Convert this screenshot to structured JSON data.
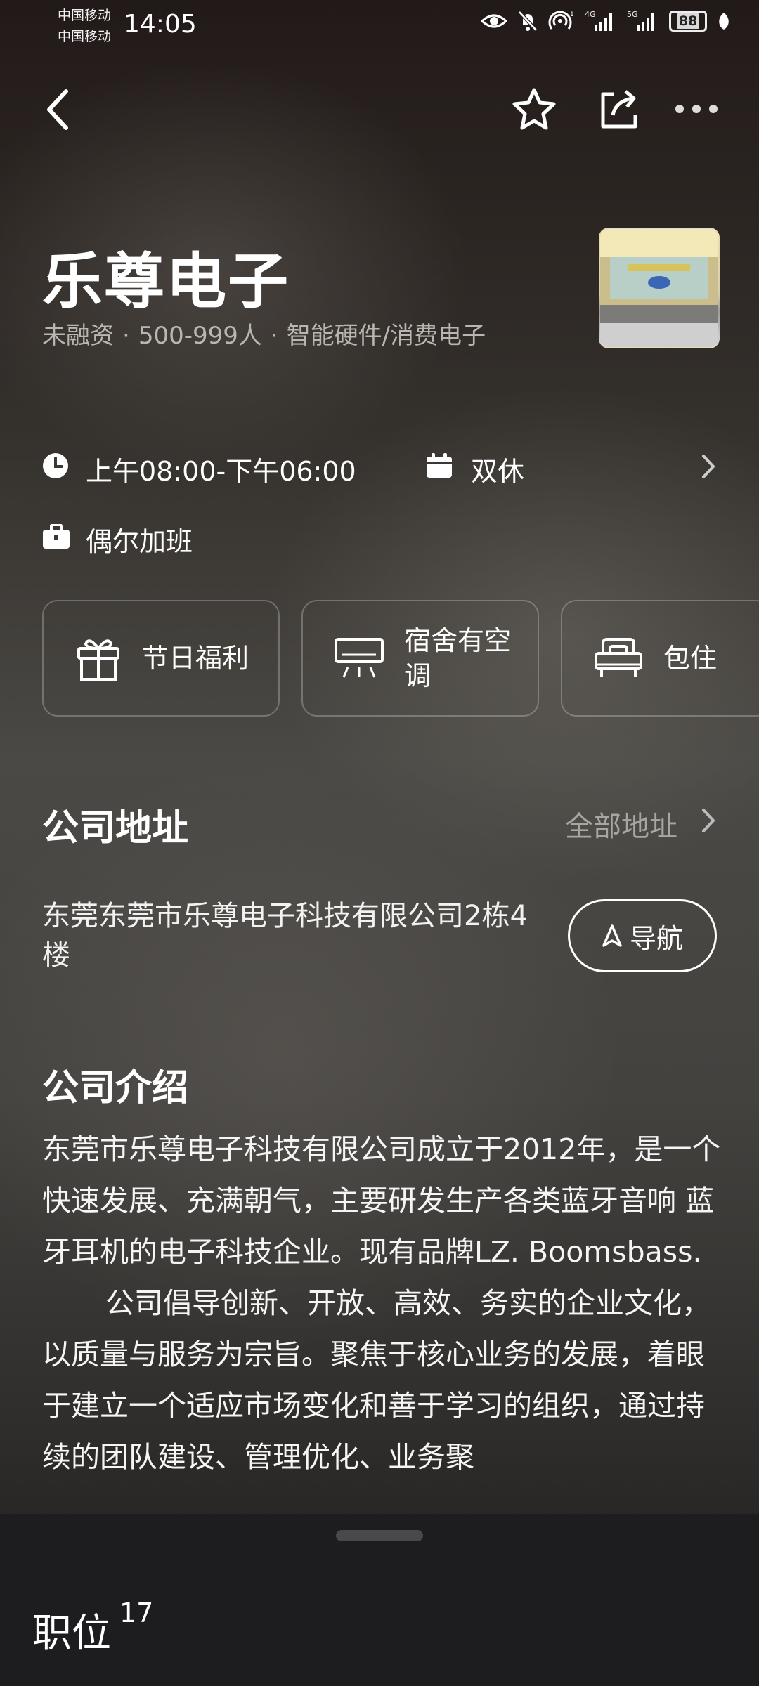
{
  "status_bar": {
    "carrier1": "中国移动",
    "carrier2": "中国移动",
    "time": "14:05",
    "battery": "88",
    "network1": "4G",
    "network2": "5G"
  },
  "company": {
    "name": "乐尊电子",
    "funding": "未融资",
    "size": "500-999人",
    "industry": "智能硬件/消费电子"
  },
  "work": {
    "hours": "上午08:00-下午06:00",
    "rest": "双休",
    "overtime": "偶尔加班"
  },
  "benefits": [
    {
      "label": "节日福利",
      "icon": "gift-icon"
    },
    {
      "label": "宿舍有空调",
      "icon": "air-conditioner-icon"
    },
    {
      "label": "包住",
      "icon": "bed-icon"
    }
  ],
  "address": {
    "title": "公司地址",
    "all_link": "全部地址",
    "text": "东莞东莞市乐尊电子科技有限公司2栋4楼",
    "nav_label": "导航"
  },
  "intro": {
    "title": "公司介绍",
    "para1": "东莞市乐尊电子科技有限公司成立于2012年，是一个快速发展、充满朝气，主要研发生产各类蓝牙音响 蓝牙耳机的电子科技企业。现有品牌LZ. Boomsbass.",
    "para2": "公司倡导创新、开放、高效、务实的企业文化，以质量与服务为宗旨。聚焦于核心业务的发展，着眼于建立一个适应市场变化和善于学习的组织，通过持续的团队建设、管理优化、业务聚"
  },
  "jobs": {
    "label": "职位",
    "count": "17"
  }
}
